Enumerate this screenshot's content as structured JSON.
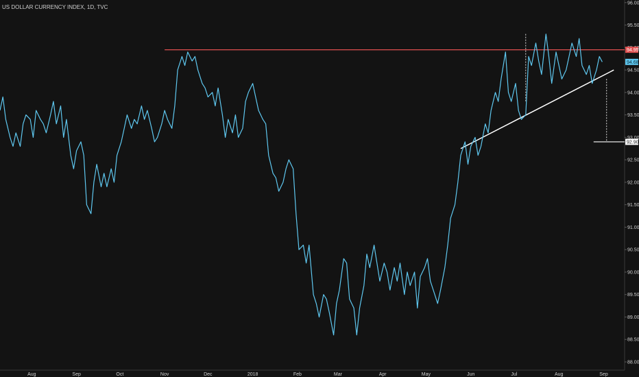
{
  "title": "US DOLLAR CURRENCY INDEX, 1D, TVC",
  "colors": {
    "background": "#131313",
    "price_line": "#5fc8f0",
    "resistance": "#e05050",
    "trendline": "#ffffff",
    "axis_text": "#cfcfcf"
  },
  "chart_data": {
    "type": "line",
    "ylim": [
      88,
      96
    ],
    "y_ticks": [
      "96.00",
      "95.50",
      "95.00",
      "94.50",
      "94.00",
      "93.50",
      "93.00",
      "92.50",
      "92.00",
      "91.50",
      "91.00",
      "90.50",
      "90.00",
      "89.50",
      "89.00",
      "88.50",
      "88.00"
    ],
    "x_ticks": [
      "Aug",
      "Sep",
      "Oct",
      "Nov",
      "Dec",
      "2018",
      "Feb",
      "Mar",
      "Apr",
      "May",
      "Jun",
      "Jul",
      "Aug",
      "Sep"
    ],
    "x_tick_dates": [
      "2017-08-01",
      "2017-09-01",
      "2017-10-01",
      "2017-11-01",
      "2017-12-01",
      "2018-01-01",
      "2018-02-01",
      "2018-03-01",
      "2018-04-01",
      "2018-05-01",
      "2018-06-01",
      "2018-07-01",
      "2018-08-01",
      "2018-09-01"
    ],
    "x_range": [
      "2017-07-10",
      "2018-09-15"
    ],
    "series": [
      {
        "type": "line",
        "points": [
          [
            "2017-07-10",
            93.6
          ],
          [
            "2017-07-12",
            93.9
          ],
          [
            "2017-07-14",
            93.4
          ],
          [
            "2017-07-17",
            93.0
          ],
          [
            "2017-07-19",
            92.8
          ],
          [
            "2017-07-21",
            93.1
          ],
          [
            "2017-07-24",
            92.8
          ],
          [
            "2017-07-26",
            93.3
          ],
          [
            "2017-07-28",
            93.5
          ],
          [
            "2017-07-31",
            93.4
          ],
          [
            "2017-08-02",
            93.0
          ],
          [
            "2017-08-04",
            93.6
          ],
          [
            "2017-08-07",
            93.4
          ],
          [
            "2017-08-09",
            93.3
          ],
          [
            "2017-08-11",
            93.1
          ],
          [
            "2017-08-14",
            93.5
          ],
          [
            "2017-08-16",
            93.8
          ],
          [
            "2017-08-18",
            93.3
          ],
          [
            "2017-08-21",
            93.7
          ],
          [
            "2017-08-23",
            93.0
          ],
          [
            "2017-08-25",
            93.4
          ],
          [
            "2017-08-28",
            92.6
          ],
          [
            "2017-08-30",
            92.3
          ],
          [
            "2017-09-01",
            92.7
          ],
          [
            "2017-09-04",
            92.9
          ],
          [
            "2017-09-06",
            92.6
          ],
          [
            "2017-09-08",
            91.5
          ],
          [
            "2017-09-11",
            91.3
          ],
          [
            "2017-09-13",
            92.0
          ],
          [
            "2017-09-15",
            92.4
          ],
          [
            "2017-09-18",
            91.9
          ],
          [
            "2017-09-20",
            92.2
          ],
          [
            "2017-09-22",
            91.9
          ],
          [
            "2017-09-25",
            92.3
          ],
          [
            "2017-09-27",
            92.0
          ],
          [
            "2017-09-29",
            92.6
          ],
          [
            "2017-10-02",
            92.9
          ],
          [
            "2017-10-04",
            93.2
          ],
          [
            "2017-10-06",
            93.5
          ],
          [
            "2017-10-09",
            93.2
          ],
          [
            "2017-10-11",
            93.4
          ],
          [
            "2017-10-13",
            93.3
          ],
          [
            "2017-10-16",
            93.7
          ],
          [
            "2017-10-18",
            93.4
          ],
          [
            "2017-10-20",
            93.6
          ],
          [
            "2017-10-23",
            93.2
          ],
          [
            "2017-10-25",
            92.9
          ],
          [
            "2017-10-27",
            93.0
          ],
          [
            "2017-10-30",
            93.3
          ],
          [
            "2017-11-01",
            93.6
          ],
          [
            "2017-11-03",
            93.4
          ],
          [
            "2017-11-06",
            93.2
          ],
          [
            "2017-11-08",
            93.7
          ],
          [
            "2017-11-10",
            94.5
          ],
          [
            "2017-11-13",
            94.8
          ],
          [
            "2017-11-15",
            94.6
          ],
          [
            "2017-11-17",
            94.9
          ],
          [
            "2017-11-20",
            94.7
          ],
          [
            "2017-11-22",
            94.8
          ],
          [
            "2017-11-24",
            94.5
          ],
          [
            "2017-11-27",
            94.2
          ],
          [
            "2017-11-29",
            94.1
          ],
          [
            "2017-12-01",
            93.9
          ],
          [
            "2017-12-04",
            94.0
          ],
          [
            "2017-12-06",
            93.7
          ],
          [
            "2017-12-08",
            94.1
          ],
          [
            "2017-12-11",
            93.5
          ],
          [
            "2017-12-13",
            93.0
          ],
          [
            "2017-12-15",
            93.4
          ],
          [
            "2017-12-18",
            93.1
          ],
          [
            "2017-12-20",
            93.5
          ],
          [
            "2017-12-22",
            93.0
          ],
          [
            "2017-12-25",
            93.2
          ],
          [
            "2017-12-27",
            93.8
          ],
          [
            "2017-12-29",
            94.0
          ],
          [
            "2018-01-01",
            94.2
          ],
          [
            "2018-01-03",
            93.9
          ],
          [
            "2018-01-05",
            93.6
          ],
          [
            "2018-01-08",
            93.4
          ],
          [
            "2018-01-10",
            93.3
          ],
          [
            "2018-01-12",
            92.6
          ],
          [
            "2018-01-15",
            92.2
          ],
          [
            "2018-01-17",
            92.1
          ],
          [
            "2018-01-19",
            91.8
          ],
          [
            "2018-01-22",
            92.0
          ],
          [
            "2018-01-24",
            92.3
          ],
          [
            "2018-01-26",
            92.5
          ],
          [
            "2018-01-29",
            92.3
          ],
          [
            "2018-01-31",
            91.3
          ],
          [
            "2018-02-02",
            90.5
          ],
          [
            "2018-02-05",
            90.6
          ],
          [
            "2018-02-07",
            90.2
          ],
          [
            "2018-02-09",
            90.6
          ],
          [
            "2018-02-12",
            89.5
          ],
          [
            "2018-02-14",
            89.3
          ],
          [
            "2018-02-16",
            89.0
          ],
          [
            "2018-02-19",
            89.5
          ],
          [
            "2018-02-21",
            89.4
          ],
          [
            "2018-02-23",
            89.1
          ],
          [
            "2018-02-26",
            88.6
          ],
          [
            "2018-02-28",
            89.3
          ],
          [
            "2018-03-02",
            89.6
          ],
          [
            "2018-03-05",
            90.3
          ],
          [
            "2018-03-07",
            90.2
          ],
          [
            "2018-03-09",
            89.4
          ],
          [
            "2018-03-12",
            89.2
          ],
          [
            "2018-03-14",
            88.6
          ],
          [
            "2018-03-16",
            89.2
          ],
          [
            "2018-03-19",
            89.7
          ],
          [
            "2018-03-21",
            90.4
          ],
          [
            "2018-03-23",
            90.1
          ],
          [
            "2018-03-26",
            90.6
          ],
          [
            "2018-03-28",
            90.2
          ],
          [
            "2018-03-30",
            89.8
          ],
          [
            "2018-04-02",
            90.2
          ],
          [
            "2018-04-04",
            90.0
          ],
          [
            "2018-04-06",
            89.6
          ],
          [
            "2018-04-09",
            90.1
          ],
          [
            "2018-04-11",
            89.8
          ],
          [
            "2018-04-13",
            90.2
          ],
          [
            "2018-04-16",
            89.5
          ],
          [
            "2018-04-18",
            90.0
          ],
          [
            "2018-04-20",
            89.7
          ],
          [
            "2018-04-23",
            90.0
          ],
          [
            "2018-04-25",
            89.2
          ],
          [
            "2018-04-27",
            89.9
          ],
          [
            "2018-04-30",
            90.1
          ],
          [
            "2018-05-02",
            90.3
          ],
          [
            "2018-05-04",
            89.8
          ],
          [
            "2018-05-07",
            89.5
          ],
          [
            "2018-05-09",
            89.3
          ],
          [
            "2018-05-11",
            89.6
          ],
          [
            "2018-05-14",
            90.1
          ],
          [
            "2018-05-16",
            90.6
          ],
          [
            "2018-05-18",
            91.2
          ],
          [
            "2018-05-21",
            91.5
          ],
          [
            "2018-05-23",
            92.0
          ],
          [
            "2018-05-25",
            92.6
          ],
          [
            "2018-05-28",
            92.9
          ],
          [
            "2018-05-30",
            92.4
          ],
          [
            "2018-06-01",
            92.8
          ],
          [
            "2018-06-04",
            93.0
          ],
          [
            "2018-06-06",
            92.6
          ],
          [
            "2018-06-08",
            92.8
          ],
          [
            "2018-06-11",
            93.3
          ],
          [
            "2018-06-13",
            93.1
          ],
          [
            "2018-06-15",
            93.6
          ],
          [
            "2018-06-18",
            94.0
          ],
          [
            "2018-06-20",
            93.8
          ],
          [
            "2018-06-22",
            94.3
          ],
          [
            "2018-06-25",
            94.9
          ],
          [
            "2018-06-27",
            94.0
          ],
          [
            "2018-06-29",
            93.8
          ],
          [
            "2018-07-02",
            94.2
          ],
          [
            "2018-07-04",
            93.6
          ],
          [
            "2018-07-06",
            93.4
          ],
          [
            "2018-07-09",
            93.5
          ],
          [
            "2018-07-11",
            94.8
          ],
          [
            "2018-07-13",
            94.6
          ],
          [
            "2018-07-16",
            95.1
          ],
          [
            "2018-07-18",
            94.7
          ],
          [
            "2018-07-20",
            94.4
          ],
          [
            "2018-07-23",
            95.3
          ],
          [
            "2018-07-25",
            94.8
          ],
          [
            "2018-07-27",
            94.2
          ],
          [
            "2018-07-30",
            94.9
          ],
          [
            "2018-08-01",
            94.6
          ],
          [
            "2018-08-03",
            94.3
          ],
          [
            "2018-08-06",
            94.5
          ],
          [
            "2018-08-08",
            94.8
          ],
          [
            "2018-08-10",
            95.1
          ],
          [
            "2018-08-13",
            94.8
          ],
          [
            "2018-08-15",
            95.2
          ],
          [
            "2018-08-17",
            94.6
          ],
          [
            "2018-08-20",
            94.4
          ],
          [
            "2018-08-22",
            94.6
          ],
          [
            "2018-08-24",
            94.2
          ],
          [
            "2018-08-27",
            94.5
          ],
          [
            "2018-08-29",
            94.8
          ],
          [
            "2018-08-31",
            94.68
          ]
        ]
      }
    ],
    "annotations": {
      "resistance": {
        "value": 94.95,
        "label": "94.95",
        "from": "2017-11-01"
      },
      "current": {
        "value": 94.68,
        "label": "94.68"
      },
      "target": {
        "value": 92.9,
        "label": "92.90",
        "from": "2018-08-25"
      },
      "trendline": {
        "start": [
          "2018-05-25",
          92.75
        ],
        "end": [
          "2018-09-08",
          94.5
        ]
      },
      "dotted_projections": [
        {
          "date": "2018-07-09",
          "top": 95.3,
          "bottom": 93.8
        },
        {
          "date": "2018-09-03",
          "top": 94.3,
          "bottom": 92.9
        }
      ]
    }
  }
}
